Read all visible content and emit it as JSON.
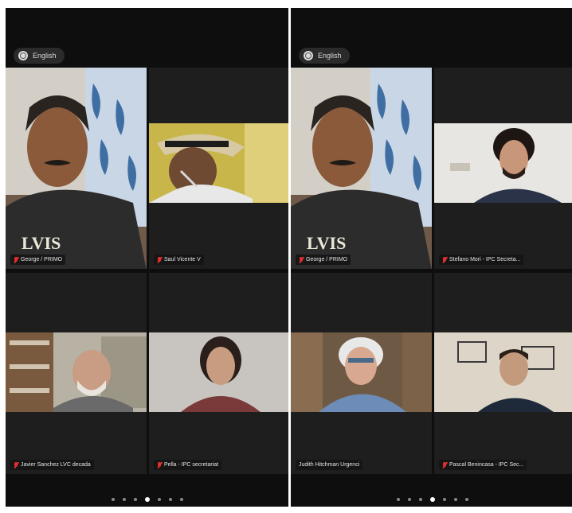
{
  "language_label": "English",
  "left_panel": {
    "participants": [
      {
        "name": "George / PRIMO",
        "muted": true
      },
      {
        "name": "Saul Vicente V",
        "muted": true
      },
      {
        "name": "Javier Sanchez LVC decada",
        "muted": true
      },
      {
        "name": "Pella - IPC secretariat",
        "muted": true
      }
    ],
    "pages": 7,
    "active_page": 3
  },
  "right_panel": {
    "participants": [
      {
        "name": "George / PRIMO",
        "muted": true
      },
      {
        "name": "Stefano Mori - IPC Secreta...",
        "muted": true
      },
      {
        "name": "Judith Hitchman Urgenci",
        "muted": false
      },
      {
        "name": "Pascal Benincasa - IPC Sec...",
        "muted": true
      }
    ],
    "pages": 7,
    "active_page": 3
  },
  "colors": {
    "background": "#0e0e0e",
    "tile": "#1e1e1e",
    "muted_icon": "#e02f2f"
  }
}
